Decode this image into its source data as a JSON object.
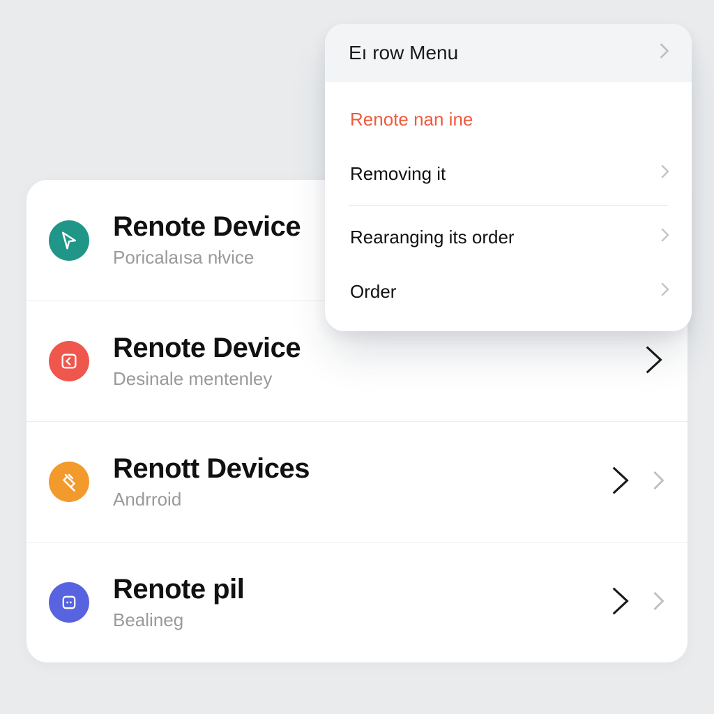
{
  "list": {
    "rows": [
      {
        "title": "Renote Device",
        "sub": "Poricalaısa nłvice",
        "iconColor": "teal",
        "icon": "pointer",
        "chevrons": 0
      },
      {
        "title": "Renote Device",
        "sub": "Desinale mentenley",
        "iconColor": "red",
        "icon": "square-chev",
        "chevrons": 1
      },
      {
        "title": "Renott Devices",
        "sub": "Andrroid",
        "iconColor": "orange",
        "icon": "plug",
        "chevrons": 2
      },
      {
        "title": "Renote pil",
        "sub": "Bealineg",
        "iconColor": "blue",
        "icon": "dots-box",
        "chevrons": 2
      }
    ]
  },
  "popover": {
    "header": "Eı row Menu",
    "items": [
      {
        "label": "Renote nan ine",
        "danger": true,
        "chevron": false
      },
      {
        "label": "Removing it",
        "danger": false,
        "chevron": true
      },
      {
        "divider": true
      },
      {
        "label": "Rearanging its order",
        "danger": false,
        "chevron": true
      },
      {
        "label": "Order",
        "danger": false,
        "chevron": true
      }
    ]
  }
}
